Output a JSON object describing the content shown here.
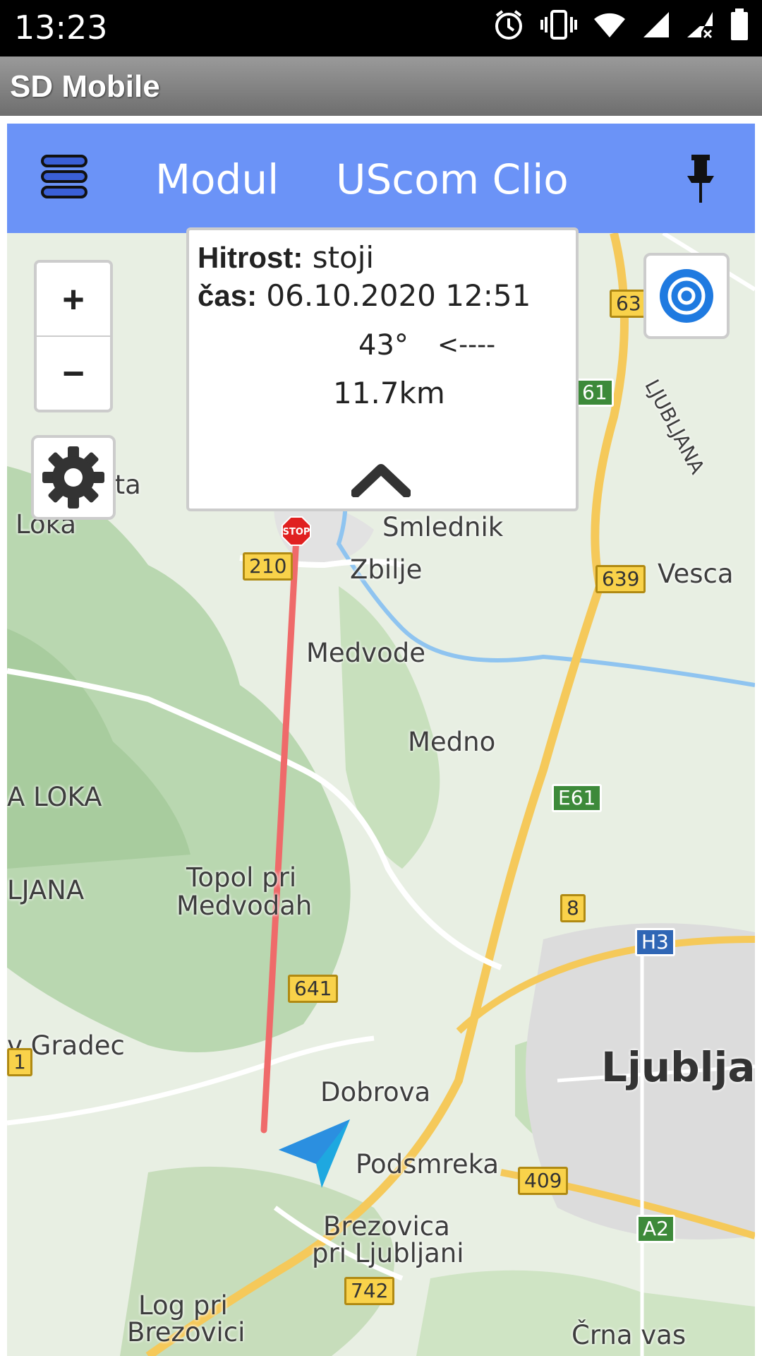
{
  "status_bar": {
    "time": "13:23",
    "icons": [
      "alarm-icon",
      "vibrate-icon",
      "wifi-icon",
      "signal-icon",
      "signal-off-icon",
      "battery-icon"
    ]
  },
  "app": {
    "title": "SD Mobile"
  },
  "topbar": {
    "menu_icon": "menu-icon",
    "module_label": "Modul",
    "device_name": "UScom Clio",
    "pin_icon": "pin-icon",
    "color": "#6b93f7"
  },
  "map_controls": {
    "zoom_in": "+",
    "zoom_out": "−",
    "settings_icon": "gear-icon",
    "locate_icon": "target-icon"
  },
  "popup": {
    "speed_label": "Hitrost:",
    "speed_value": "stoji",
    "time_label": "čas:",
    "time_value": "06.10.2020 12:51",
    "heading": "43°",
    "direction": "<----",
    "distance": "11.7km",
    "collapse_icon": "chevron-up-icon"
  },
  "map": {
    "labels": [
      {
        "text": "Smlednik"
      },
      {
        "text": "Zbilje"
      },
      {
        "text": "Medvode"
      },
      {
        "text": "Medno"
      },
      {
        "text": "Vesca"
      },
      {
        "text": "Loka"
      },
      {
        "text": "ata"
      },
      {
        "text": "A LOKA"
      },
      {
        "text": "LJANA"
      },
      {
        "text": "Topol pri"
      },
      {
        "text": "Medvodah"
      },
      {
        "text": "v Gradec"
      },
      {
        "text": "Dobrova"
      },
      {
        "text": "Podsmreka"
      },
      {
        "text": "Brezovica"
      },
      {
        "text": "pri Ljubljani"
      },
      {
        "text": "Log pri"
      },
      {
        "text": "Brezovici"
      },
      {
        "text": "Ljubljan"
      },
      {
        "text": "Črna vas"
      },
      {
        "text": "LJUBLJANA"
      }
    ],
    "road_shields": [
      {
        "text": "210"
      },
      {
        "text": "639"
      },
      {
        "text": "E61"
      },
      {
        "text": "61"
      },
      {
        "text": "63"
      },
      {
        "text": "8"
      },
      {
        "text": "H3"
      },
      {
        "text": "641"
      },
      {
        "text": "409"
      },
      {
        "text": "A2"
      },
      {
        "text": "742"
      },
      {
        "text": "1"
      }
    ],
    "stop_marker_text": "STOP",
    "route_color": "#ef6a6a",
    "vehicle_icon": "navigation-arrow-icon"
  }
}
